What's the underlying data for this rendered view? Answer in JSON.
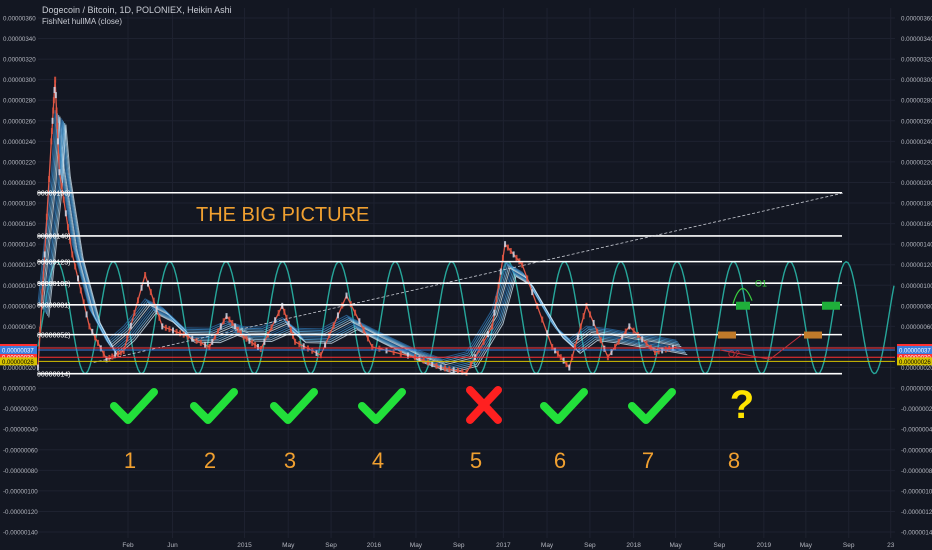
{
  "header": {
    "symbol_line": "Dogecoin / Bitcoin, 1D, POLONIEX, Heikin Ashi",
    "indicator_line": "FishNet hullMA (close)"
  },
  "colors": {
    "background": "#131722",
    "axis_text": "#b2b5be",
    "grid": "#1e2230",
    "level_line": "#ffffff",
    "sine": "#26a69a",
    "annotation_orange": "#f0a030",
    "check_green": "#22e03a",
    "cross_red": "#ff2020",
    "question_yellow": "#ffe400",
    "yellow_line": "#d6c200",
    "red_line": "#ff3030",
    "blue_line": "#3b7ddd",
    "target_green": "#1fae3a",
    "target_orange": "#c07a2a",
    "forecast_green": "#3ad040",
    "forecast_red": "#c0303a"
  },
  "chart_data": {
    "type": "line",
    "title": "THE BIG PICTURE",
    "x_tick_labels": [
      "Feb",
      "Jun",
      "2015",
      "May",
      "Sep",
      "2016",
      "May",
      "Sep",
      "2017",
      "May",
      "Sep",
      "2018",
      "May",
      "Sep",
      "2019",
      "May",
      "Sep",
      "23"
    ],
    "y_tick_labels": [
      "0.00000360",
      "0.00000340",
      "0.00000320",
      "0.00000300",
      "0.00000280",
      "0.00000260",
      "0.00000240",
      "0.00000220",
      "0.00000200",
      "0.00000180",
      "0.00000160",
      "0.00000140",
      "0.00000120",
      "0.00000100",
      "0.00000080",
      "0.00000060",
      "0.00000040",
      "0.00000020",
      "0.00000000",
      "-0.00000020",
      "-0.00000040",
      "-0.00000060",
      "-0.00000080",
      "-0.00000100",
      "-0.00000120",
      "-0.00000140"
    ],
    "ylim": [
      -1.4e-06,
      3.6e-06
    ],
    "levels": [
      {
        "label": "00000190)",
        "value": 1.9e-06
      },
      {
        "label": "00000148)",
        "value": 1.48e-06
      },
      {
        "label": "00000123)",
        "value": 1.23e-06
      },
      {
        "label": "00000102)",
        "value": 1.02e-06
      },
      {
        "label": "00000081)",
        "value": 8.1e-07
      },
      {
        "label": "00000052)",
        "value": 5.2e-07
      },
      {
        "label": "00000014)",
        "value": 1.4e-07
      }
    ],
    "price_tags": [
      {
        "label": "0.00000039",
        "value": 3.9e-07,
        "color": "#ff3030"
      },
      {
        "label": "0.00000030",
        "value": 3e-07,
        "color": "#ff3030"
      },
      {
        "label": "0.00000037",
        "value": 3.7e-07,
        "color": "#3b7ddd"
      },
      {
        "label": "0.00000026",
        "value": 2.6e-07,
        "color": "#d6c200"
      }
    ],
    "cycles": [
      {
        "number": "1",
        "result": "check"
      },
      {
        "number": "2",
        "result": "check"
      },
      {
        "number": "3",
        "result": "check"
      },
      {
        "number": "4",
        "result": "check"
      },
      {
        "number": "5",
        "result": "cross"
      },
      {
        "number": "6",
        "result": "check"
      },
      {
        "number": "7",
        "result": "check"
      },
      {
        "number": "8",
        "result": "question"
      }
    ],
    "question_mark": "?",
    "forecast_labels": [
      "O1",
      "O2"
    ],
    "price_path": [
      [
        0,
        2e-07
      ],
      [
        0.0155,
        2.4e-06
      ],
      [
        0.02,
        3e-06
      ],
      [
        0.025,
        2.1e-06
      ],
      [
        0.04,
        1.3e-06
      ],
      [
        0.06,
        6e-07
      ],
      [
        0.08,
        2.8e-07
      ],
      [
        0.1,
        3.6e-07
      ],
      [
        0.125,
        1.1e-06
      ],
      [
        0.145,
        6e-07
      ],
      [
        0.17,
        5.2e-07
      ],
      [
        0.2,
        4e-07
      ],
      [
        0.22,
        7e-07
      ],
      [
        0.24,
        5e-07
      ],
      [
        0.26,
        3.8e-07
      ],
      [
        0.285,
        8e-07
      ],
      [
        0.3,
        4.5e-07
      ],
      [
        0.33,
        3.2e-07
      ],
      [
        0.36,
        9e-07
      ],
      [
        0.39,
        4e-07
      ],
      [
        0.44,
        3e-07
      ],
      [
        0.47,
        2e-07
      ],
      [
        0.5,
        1.5e-07
      ],
      [
        0.53,
        6e-07
      ],
      [
        0.545,
        1.4e-06
      ],
      [
        0.565,
        1.2e-06
      ],
      [
        0.6,
        4e-07
      ],
      [
        0.62,
        2e-07
      ],
      [
        0.64,
        8e-07
      ],
      [
        0.665,
        3e-07
      ],
      [
        0.69,
        6e-07
      ],
      [
        0.72,
        3.5e-07
      ],
      [
        0.745,
        4e-07
      ]
    ]
  }
}
